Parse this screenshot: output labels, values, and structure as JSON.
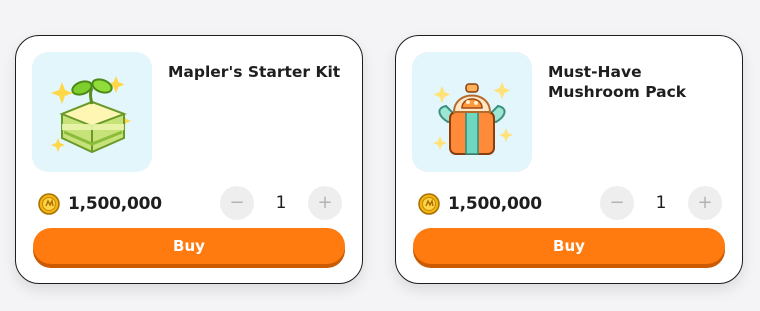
{
  "colors": {
    "accent": "#ff7a0f",
    "accent_shadow": "#cc5a00",
    "thumbnail_bg": "#e3f6fb",
    "card_border": "#1e1e1e"
  },
  "products": [
    {
      "name": "Mapler's Starter Kit",
      "icon": "sprout-gift-box-icon",
      "currency_icon": "meso-coin-icon",
      "price": "1,500,000",
      "quantity": "1",
      "minus_label": "−",
      "plus_label": "+",
      "buy_label": "Buy"
    },
    {
      "name": "Must-Have Mushroom Pack",
      "icon": "mushroom-gift-jar-icon",
      "currency_icon": "meso-coin-icon",
      "price": "1,500,000",
      "quantity": "1",
      "minus_label": "−",
      "plus_label": "+",
      "buy_label": "Buy"
    }
  ]
}
